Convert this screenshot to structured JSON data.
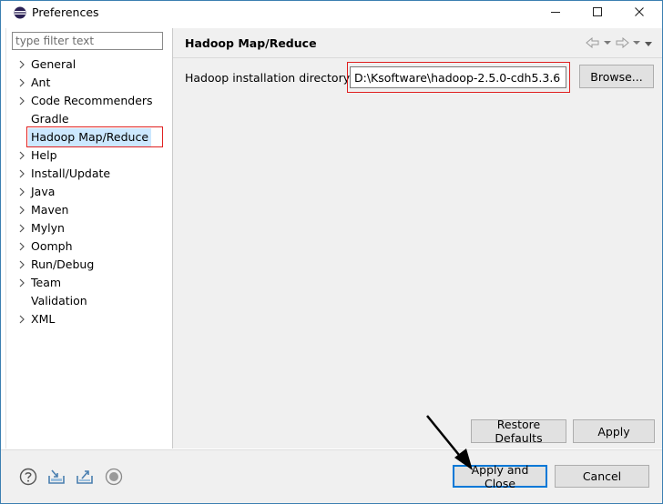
{
  "window": {
    "title": "Preferences"
  },
  "filter": {
    "placeholder": "type filter text"
  },
  "tree": {
    "items": [
      {
        "label": "General",
        "expandable": true
      },
      {
        "label": "Ant",
        "expandable": true
      },
      {
        "label": "Code Recommenders",
        "expandable": true
      },
      {
        "label": "Gradle",
        "expandable": false
      },
      {
        "label": "Hadoop Map/Reduce",
        "expandable": false,
        "selected": true
      },
      {
        "label": "Help",
        "expandable": true
      },
      {
        "label": "Install/Update",
        "expandable": true
      },
      {
        "label": "Java",
        "expandable": true
      },
      {
        "label": "Maven",
        "expandable": true
      },
      {
        "label": "Mylyn",
        "expandable": true
      },
      {
        "label": "Oomph",
        "expandable": true
      },
      {
        "label": "Run/Debug",
        "expandable": true
      },
      {
        "label": "Team",
        "expandable": true
      },
      {
        "label": "Validation",
        "expandable": false
      },
      {
        "label": "XML",
        "expandable": true
      }
    ]
  },
  "page": {
    "title": "Hadoop Map/Reduce",
    "dir_label": "Hadoop installation directory:",
    "dir_value": "D:\\Ksoftware\\hadoop-2.5.0-cdh5.3.6",
    "browse_label": "Browse...",
    "restore_label": "Restore Defaults",
    "apply_label": "Apply"
  },
  "footer": {
    "apply_close_label": "Apply and Close",
    "cancel_label": "Cancel",
    "icons": [
      "help-icon",
      "import-icon",
      "export-icon",
      "record-icon"
    ]
  },
  "colors": {
    "highlight_red": "#e02020",
    "selection": "#cce8ff",
    "focus_blue": "#0078d7"
  }
}
